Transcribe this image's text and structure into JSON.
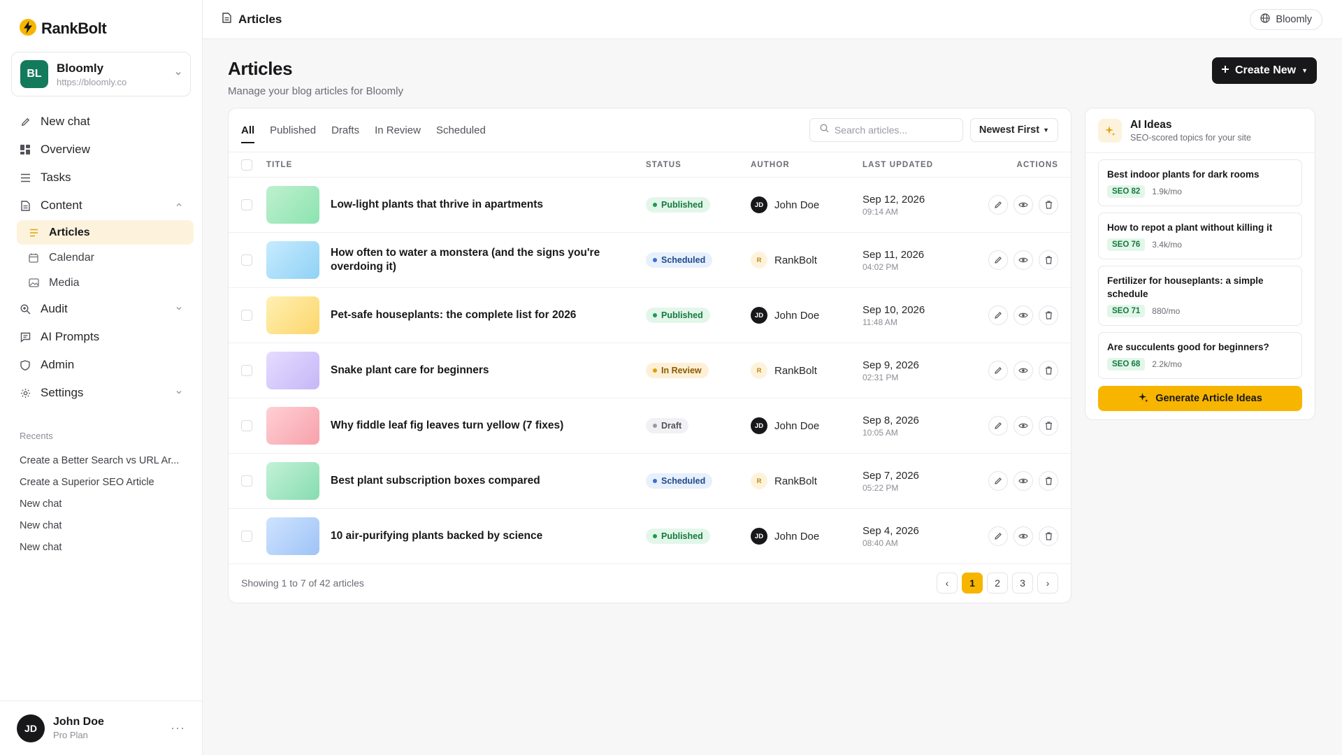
{
  "brand": {
    "name": "RankBolt",
    "accent": "#f7b500"
  },
  "workspace": {
    "initials": "BL",
    "name": "Bloomly",
    "url": "https://bloomly.co",
    "color": "#137a5b"
  },
  "nav": {
    "new_chat": "New chat",
    "overview": "Overview",
    "tasks": "Tasks",
    "content": "Content",
    "articles": "Articles",
    "calendar": "Calendar",
    "media": "Media",
    "audit": "Audit",
    "ai_prompts": "AI Prompts",
    "admin": "Admin",
    "settings": "Settings"
  },
  "recents": {
    "title": "Recents",
    "items": [
      "Create a Better Search vs URL Ar...",
      "Create a Superior SEO Article",
      "New chat",
      "New chat",
      "New chat"
    ]
  },
  "user": {
    "initials": "JD",
    "name": "John Doe",
    "plan": "Pro Plan"
  },
  "topbar": {
    "title": "Articles",
    "site": "Bloomly"
  },
  "page": {
    "title": "Articles",
    "subtitle": "Manage your blog articles for Bloomly",
    "create_label": "Create New"
  },
  "tabs": [
    "All",
    "Published",
    "Drafts",
    "In Review",
    "Scheduled"
  ],
  "search": {
    "placeholder": "Search articles..."
  },
  "sort": {
    "label": "Newest First"
  },
  "columns": {
    "title": "TITLE",
    "status": "STATUS",
    "author": "AUTHOR",
    "updated": "LAST UPDATED",
    "actions": "ACTIONS"
  },
  "articles": [
    {
      "title": "Low-light plants that thrive in apartments",
      "status": "Published",
      "author": "John Doe",
      "author_initials": "JD",
      "date": "Sep 12, 2026",
      "time": "09:14 AM",
      "thumb": [
        "#bff0cf",
        "#8ce3b0"
      ]
    },
    {
      "title": "How often to water a monstera (and the signs you're overdoing it)",
      "status": "Scheduled",
      "author": "RankBolt",
      "author_initials": "R",
      "date": "Sep 11, 2026",
      "time": "04:02 PM",
      "thumb": [
        "#c7ebff",
        "#8fd2f5"
      ]
    },
    {
      "title": "Pet-safe houseplants: the complete list for 2026",
      "status": "Published",
      "author": "John Doe",
      "author_initials": "JD",
      "date": "Sep 10, 2026",
      "time": "11:48 AM",
      "thumb": [
        "#fff0b3",
        "#fcd66b"
      ]
    },
    {
      "title": "Snake plant care for beginners",
      "status": "In Review",
      "author": "RankBolt",
      "author_initials": "R",
      "date": "Sep 9, 2026",
      "time": "02:31 PM",
      "thumb": [
        "#e6dcff",
        "#c6b6f7"
      ]
    },
    {
      "title": "Why fiddle leaf fig leaves turn yellow (7 fixes)",
      "status": "Draft",
      "author": "John Doe",
      "author_initials": "JD",
      "date": "Sep 8, 2026",
      "time": "10:05 AM",
      "thumb": [
        "#ffd0d4",
        "#f7a1ab"
      ]
    },
    {
      "title": "Best plant subscription boxes compared",
      "status": "Scheduled",
      "author": "RankBolt",
      "author_initials": "R",
      "date": "Sep 7, 2026",
      "time": "05:22 PM",
      "thumb": [
        "#c4f2d8",
        "#86dcb0"
      ]
    },
    {
      "title": "10 air-purifying plants backed by science",
      "status": "Published",
      "author": "John Doe",
      "author_initials": "JD",
      "date": "Sep 4, 2026",
      "time": "08:40 AM",
      "thumb": [
        "#cfe3ff",
        "#9ec3f6"
      ]
    }
  ],
  "footer": {
    "showing": "Showing 1 to 7 of 42 articles",
    "pages": [
      "1",
      "2",
      "3"
    ],
    "prev": "‹",
    "next": "›"
  },
  "ideas": {
    "title": "AI Ideas",
    "subtitle": "SEO-scored topics for your site",
    "items": [
      {
        "title": "Best indoor plants for dark rooms",
        "seo": "SEO 82",
        "volume": "1.9k/mo"
      },
      {
        "title": "How to repot a plant without killing it",
        "seo": "SEO 76",
        "volume": "3.4k/mo"
      },
      {
        "title": "Fertilizer for houseplants: a simple schedule",
        "seo": "SEO 71",
        "volume": "880/mo"
      },
      {
        "title": "Are succulents good for beginners?",
        "seo": "SEO 68",
        "volume": "2.2k/mo"
      }
    ],
    "generate_label": "Generate Article Ideas"
  }
}
